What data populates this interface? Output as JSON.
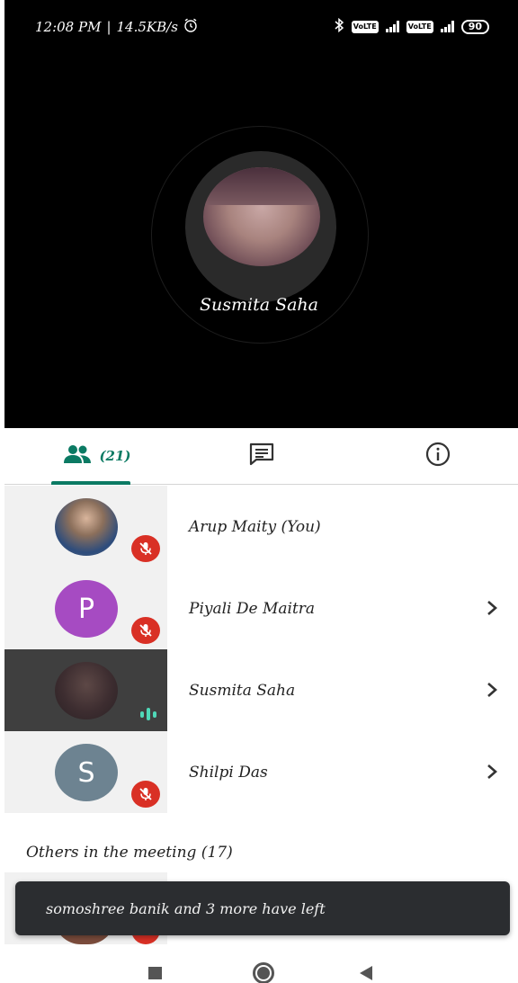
{
  "status_bar": {
    "time": "12:08 PM",
    "speed": "14.5KB/s",
    "alarm_icon": "alarm-clock-icon",
    "bluetooth_icon": "bluetooth-icon",
    "battery": "90"
  },
  "speaker": {
    "name": "Susmita Saha"
  },
  "tabs": {
    "people_count": "(21)",
    "people_icon": "people-icon",
    "chat_icon": "chat-icon",
    "info_icon": "info-icon",
    "accent": "#0b7a63"
  },
  "participants": [
    {
      "name": "Arup Maity (You)",
      "initial": "",
      "muted": true,
      "has_chevron": false
    },
    {
      "name": "Piyali De Maitra",
      "initial": "P",
      "muted": true,
      "has_chevron": true
    },
    {
      "name": "Susmita Saha",
      "initial": "",
      "muted": false,
      "speaking": true,
      "has_chevron": true
    },
    {
      "name": "Shilpi Das",
      "initial": "S",
      "muted": true,
      "has_chevron": true
    }
  ],
  "others": {
    "label": "Others in the meeting (17)"
  },
  "snackbar": {
    "message": "somoshree banik and 3 more have left"
  },
  "colors": {
    "mute_red": "#d93025",
    "speaking_teal": "#4fd8b8",
    "piyali_avatar": "#a64bc2",
    "shilpi_avatar": "#6d8391"
  }
}
